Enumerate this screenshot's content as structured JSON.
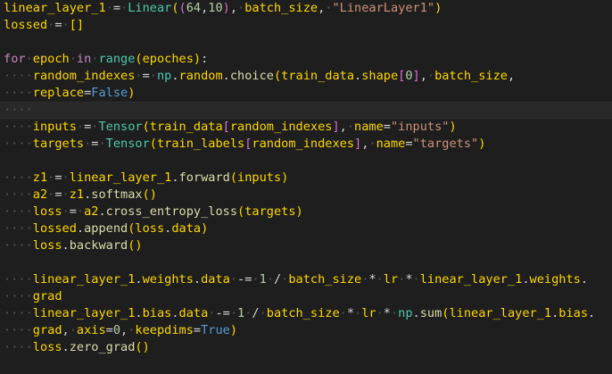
{
  "colors": {
    "background": "#1e1e1e",
    "text": "#d4d4d4",
    "variable": "#ffd700",
    "class": "#4ec9b0",
    "function": "#dcdcaa",
    "keyword": "#c586c0",
    "number": "#b5cea8",
    "string": "#ce9178",
    "boolean": "#569cd6"
  },
  "lines": [
    {
      "current": false,
      "tokens": [
        [
          "var",
          "linear_layer_1"
        ],
        [
          "op",
          " = "
        ],
        [
          "cls",
          "Linear"
        ],
        [
          "p1",
          "("
        ],
        [
          "p2",
          "("
        ],
        [
          "num",
          "64"
        ],
        [
          "op",
          ","
        ],
        [
          "num",
          "10"
        ],
        [
          "p2",
          ")"
        ],
        [
          "op",
          ", "
        ],
        [
          "var",
          "batch_size"
        ],
        [
          "op",
          ", "
        ],
        [
          "str",
          "\"LinearLayer1\""
        ],
        [
          "p1",
          ")"
        ]
      ]
    },
    {
      "current": false,
      "tokens": [
        [
          "var",
          "lossed"
        ],
        [
          "op",
          " = "
        ],
        [
          "p1",
          "[]"
        ]
      ]
    },
    {
      "current": false,
      "tokens": []
    },
    {
      "current": false,
      "tokens": [
        [
          "kw",
          "for"
        ],
        [
          "op",
          " "
        ],
        [
          "var",
          "epoch"
        ],
        [
          "op",
          " "
        ],
        [
          "kw",
          "in"
        ],
        [
          "op",
          " "
        ],
        [
          "cls",
          "range"
        ],
        [
          "p1",
          "("
        ],
        [
          "var",
          "epoches"
        ],
        [
          "p1",
          ")"
        ],
        [
          "op",
          ":"
        ]
      ]
    },
    {
      "current": false,
      "tokens": [
        [
          "ind",
          "    "
        ],
        [
          "var",
          "random_indexes"
        ],
        [
          "op",
          " = "
        ],
        [
          "cls",
          "np"
        ],
        [
          "op",
          "."
        ],
        [
          "var",
          "random"
        ],
        [
          "op",
          "."
        ],
        [
          "fn",
          "choice"
        ],
        [
          "p1",
          "("
        ],
        [
          "var",
          "train_data"
        ],
        [
          "op",
          "."
        ],
        [
          "var",
          "shape"
        ],
        [
          "p2",
          "["
        ],
        [
          "num",
          "0"
        ],
        [
          "p2",
          "]"
        ],
        [
          "op",
          ", "
        ],
        [
          "var",
          "batch_size"
        ],
        [
          "op",
          ","
        ]
      ]
    },
    {
      "current": false,
      "tokens": [
        [
          "ind",
          "    "
        ],
        [
          "var",
          "replace"
        ],
        [
          "op",
          "="
        ],
        [
          "bool",
          "False"
        ],
        [
          "p1",
          ")"
        ]
      ]
    },
    {
      "current": true,
      "tokens": [
        [
          "ind",
          "    "
        ]
      ]
    },
    {
      "current": false,
      "tokens": [
        [
          "ind",
          "    "
        ],
        [
          "var",
          "inputs"
        ],
        [
          "op",
          " = "
        ],
        [
          "cls",
          "Tensor"
        ],
        [
          "p1",
          "("
        ],
        [
          "var",
          "train_data"
        ],
        [
          "p2",
          "["
        ],
        [
          "var",
          "random_indexes"
        ],
        [
          "p2",
          "]"
        ],
        [
          "op",
          ", "
        ],
        [
          "var",
          "name"
        ],
        [
          "op",
          "="
        ],
        [
          "str",
          "\"inputs\""
        ],
        [
          "p1",
          ")"
        ]
      ]
    },
    {
      "current": false,
      "tokens": [
        [
          "ind",
          "    "
        ],
        [
          "var",
          "targets"
        ],
        [
          "op",
          " = "
        ],
        [
          "cls",
          "Tensor"
        ],
        [
          "p1",
          "("
        ],
        [
          "var",
          "train_labels"
        ],
        [
          "p2",
          "["
        ],
        [
          "var",
          "random_indexes"
        ],
        [
          "p2",
          "]"
        ],
        [
          "op",
          ", "
        ],
        [
          "var",
          "name"
        ],
        [
          "op",
          "="
        ],
        [
          "str",
          "\"targets\""
        ],
        [
          "p1",
          ")"
        ]
      ]
    },
    {
      "current": false,
      "tokens": []
    },
    {
      "current": false,
      "tokens": [
        [
          "ind",
          "    "
        ],
        [
          "var",
          "z1"
        ],
        [
          "op",
          " = "
        ],
        [
          "var",
          "linear_layer_1"
        ],
        [
          "op",
          "."
        ],
        [
          "fn",
          "forward"
        ],
        [
          "p1",
          "("
        ],
        [
          "var",
          "inputs"
        ],
        [
          "p1",
          ")"
        ]
      ]
    },
    {
      "current": false,
      "tokens": [
        [
          "ind",
          "    "
        ],
        [
          "var",
          "a2"
        ],
        [
          "op",
          " = "
        ],
        [
          "var",
          "z1"
        ],
        [
          "op",
          "."
        ],
        [
          "fn",
          "softmax"
        ],
        [
          "p1",
          "()"
        ]
      ]
    },
    {
      "current": false,
      "tokens": [
        [
          "ind",
          "    "
        ],
        [
          "var",
          "loss"
        ],
        [
          "op",
          " = "
        ],
        [
          "var",
          "a2"
        ],
        [
          "op",
          "."
        ],
        [
          "fn",
          "cross_entropy_loss"
        ],
        [
          "p1",
          "("
        ],
        [
          "var",
          "targets"
        ],
        [
          "p1",
          ")"
        ]
      ]
    },
    {
      "current": false,
      "tokens": [
        [
          "ind",
          "    "
        ],
        [
          "var",
          "lossed"
        ],
        [
          "op",
          "."
        ],
        [
          "fn",
          "append"
        ],
        [
          "p1",
          "("
        ],
        [
          "var",
          "loss"
        ],
        [
          "op",
          "."
        ],
        [
          "var",
          "data"
        ],
        [
          "p1",
          ")"
        ]
      ]
    },
    {
      "current": false,
      "tokens": [
        [
          "ind",
          "    "
        ],
        [
          "var",
          "loss"
        ],
        [
          "op",
          "."
        ],
        [
          "fn",
          "backward"
        ],
        [
          "p1",
          "()"
        ]
      ]
    },
    {
      "current": false,
      "tokens": []
    },
    {
      "current": false,
      "tokens": [
        [
          "ind",
          "    "
        ],
        [
          "var",
          "linear_layer_1"
        ],
        [
          "op",
          "."
        ],
        [
          "var",
          "weights"
        ],
        [
          "op",
          "."
        ],
        [
          "var",
          "data"
        ],
        [
          "op",
          " -= "
        ],
        [
          "num",
          "1"
        ],
        [
          "op",
          " / "
        ],
        [
          "var",
          "batch_size"
        ],
        [
          "op",
          " * "
        ],
        [
          "var",
          "lr"
        ],
        [
          "op",
          " * "
        ],
        [
          "var",
          "linear_layer_1"
        ],
        [
          "op",
          "."
        ],
        [
          "var",
          "weights"
        ],
        [
          "op",
          "."
        ]
      ]
    },
    {
      "current": false,
      "tokens": [
        [
          "ind",
          "    "
        ],
        [
          "var",
          "grad"
        ]
      ]
    },
    {
      "current": false,
      "tokens": [
        [
          "ind",
          "    "
        ],
        [
          "var",
          "linear_layer_1"
        ],
        [
          "op",
          "."
        ],
        [
          "var",
          "bias"
        ],
        [
          "op",
          "."
        ],
        [
          "var",
          "data"
        ],
        [
          "op",
          " -= "
        ],
        [
          "num",
          "1"
        ],
        [
          "op",
          " / "
        ],
        [
          "var",
          "batch_size"
        ],
        [
          "op",
          " * "
        ],
        [
          "var",
          "lr"
        ],
        [
          "op",
          " * "
        ],
        [
          "cls",
          "np"
        ],
        [
          "op",
          "."
        ],
        [
          "fn",
          "sum"
        ],
        [
          "p1",
          "("
        ],
        [
          "var",
          "linear_layer_1"
        ],
        [
          "op",
          "."
        ],
        [
          "var",
          "bias"
        ],
        [
          "op",
          "."
        ]
      ]
    },
    {
      "current": false,
      "tokens": [
        [
          "ind",
          "    "
        ],
        [
          "var",
          "grad"
        ],
        [
          "op",
          ", "
        ],
        [
          "var",
          "axis"
        ],
        [
          "op",
          "="
        ],
        [
          "num",
          "0"
        ],
        [
          "op",
          ", "
        ],
        [
          "var",
          "keepdims"
        ],
        [
          "op",
          "="
        ],
        [
          "bool",
          "True"
        ],
        [
          "p1",
          ")"
        ]
      ]
    },
    {
      "current": false,
      "tokens": [
        [
          "ind",
          "    "
        ],
        [
          "var",
          "loss"
        ],
        [
          "op",
          "."
        ],
        [
          "fn",
          "zero_grad"
        ],
        [
          "p1",
          "()"
        ]
      ]
    }
  ]
}
